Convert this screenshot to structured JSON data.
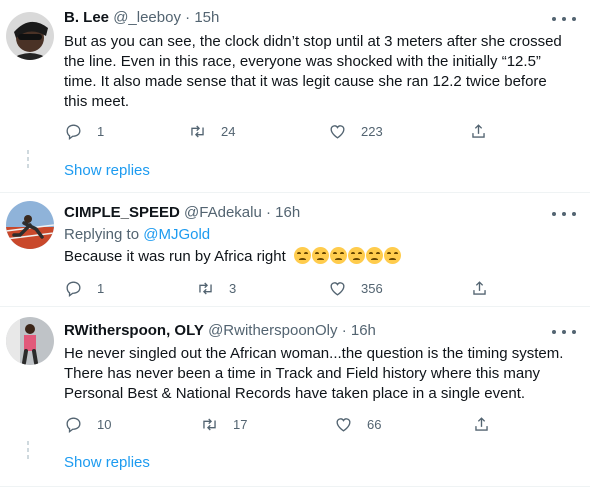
{
  "tweets": [
    {
      "name": "B. Lee",
      "handle": "@_leeboy",
      "dot": "·",
      "time": "15h",
      "text": "But as you can see, the clock didn’t stop until at 3 meters after she crossed the line. Even in this race, everyone was shocked with the initially “12.5” time. It also made sense that it was legit cause she ran 12.2 twice before this meet.",
      "replies": "1",
      "retweets": "24",
      "likes": "223",
      "show_replies": "Show replies"
    },
    {
      "name": "CIMPLE_SPEED",
      "handle": "@FAdekalu",
      "dot": "·",
      "time": "16h",
      "replying_label": "Replying to",
      "replying_to": "@MJGold",
      "text": "Because it was run by Africa right",
      "emoji_count": 6,
      "replies": "1",
      "retweets": "3",
      "likes": "356"
    },
    {
      "name": "RWitherspoon, OLY",
      "handle": "@RwitherspoonOly",
      "dot": "·",
      "time": "16h",
      "text": "He never singled out the African woman...the question is the timing system. There has never been a time in Track and Field history where this many Personal Best & National Records have taken place in a single event.",
      "replies": "10",
      "retweets": "17",
      "likes": "66",
      "show_replies": "Show replies"
    }
  ],
  "colors": {
    "text": "#0f1419",
    "secondary": "#536471",
    "link": "#1d9bf0",
    "divider": "#eff3f4"
  },
  "icons": [
    "reply-icon",
    "retweet-icon",
    "like-icon",
    "share-icon",
    "more-icon",
    "unamused-face-emoji"
  ]
}
